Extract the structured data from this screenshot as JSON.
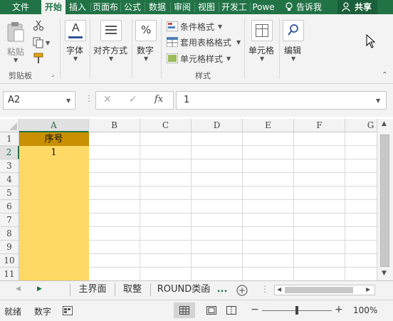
{
  "tabs": [
    {
      "label": "文件",
      "active": false
    },
    {
      "label": "开始",
      "active": true
    },
    {
      "label": "插入",
      "active": false
    },
    {
      "label": "页面布",
      "active": false
    },
    {
      "label": "公式",
      "active": false
    },
    {
      "label": "数据",
      "active": false
    },
    {
      "label": "审阅",
      "active": false
    },
    {
      "label": "视图",
      "active": false
    },
    {
      "label": "开发工",
      "active": false
    },
    {
      "label": "Powe",
      "active": false
    }
  ],
  "tell_me": "告诉我",
  "share": "共享",
  "ribbon": {
    "paste": "粘贴",
    "clipboard_group": "剪贴板",
    "font": "字体",
    "alignment": "对齐方式",
    "number": "数字",
    "conditional_format": "条件格式",
    "table_format": "套用表格格式",
    "cell_style": "单元格样式",
    "styles_group": "样式",
    "cells": "单元格",
    "editing": "编辑",
    "font_icon_letter": "A",
    "number_icon": "%"
  },
  "formula_bar": {
    "name_box": "A2",
    "formula": "1",
    "fx": "fx"
  },
  "columns": [
    "A",
    "B",
    "C",
    "D",
    "E",
    "F",
    "G"
  ],
  "rows": [
    "1",
    "2",
    "3",
    "4",
    "5",
    "6",
    "7",
    "8",
    "9",
    "10",
    "11"
  ],
  "cells": {
    "A1": "序号",
    "A2": "1"
  },
  "colors": {
    "header_fill": "#c89000",
    "column_fill": "#ffd966",
    "accent": "#217346"
  },
  "sheets": [
    "主界面",
    "取整",
    "ROUND类函",
    "..."
  ],
  "status": {
    "ready": "就绪",
    "numlock": "数字",
    "zoom": "100%"
  },
  "icons": {
    "scissors": "scissors-icon",
    "copy": "copy-icon",
    "format_painter": "format-painter-icon",
    "search": "search-icon",
    "add_sheet": "plus-icon"
  }
}
